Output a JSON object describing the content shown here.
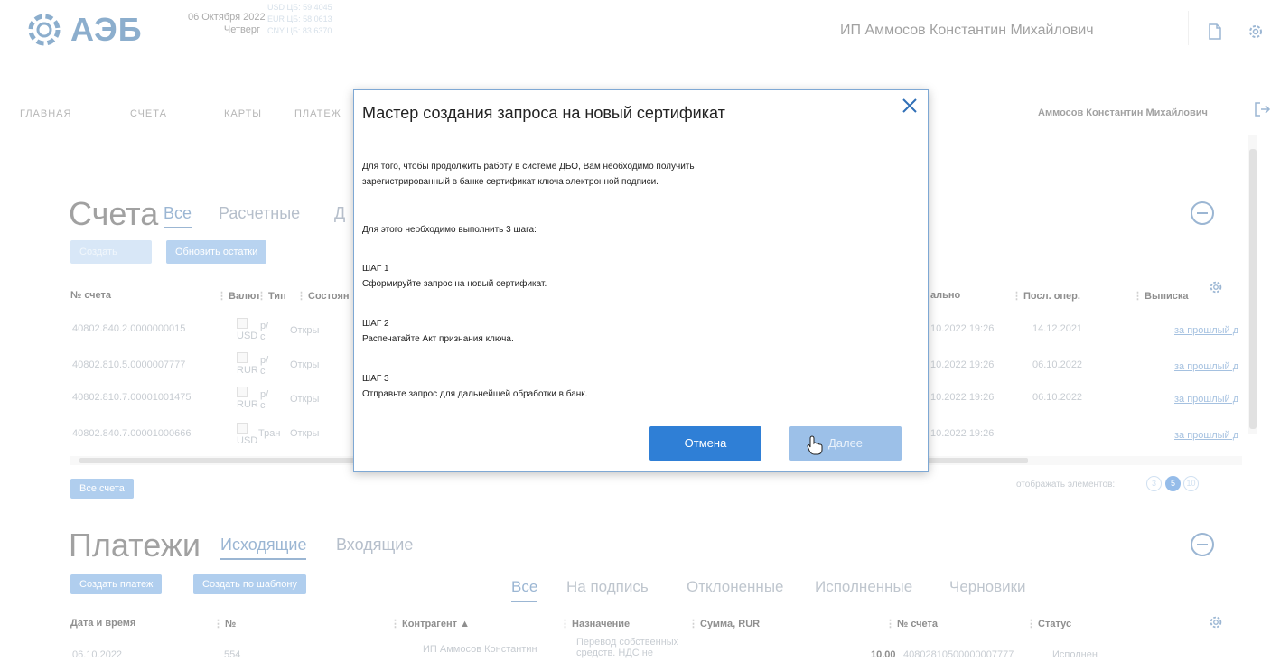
{
  "header": {
    "logo_text": "АЭБ",
    "date": "06 Октября 2022",
    "weekday": "Четверг",
    "rates": [
      "USD ЦБ: 59,4045",
      "EUR ЦБ: 58,0613",
      "CNY ЦБ: 83,6370"
    ],
    "company": "ИП Аммосов Константин Михайлович"
  },
  "nav": {
    "items": [
      "ГЛАВНАЯ",
      "СЧЕТА",
      "КАРТЫ",
      "ПЛАТЕЖ"
    ],
    "user": "Аммосов Константин Михайлович"
  },
  "accounts": {
    "title": "Счета",
    "tabs": [
      "Все",
      "Расчетные",
      "Д"
    ],
    "btn_hidden": "Создать",
    "btn_refresh": "Обновить остатки",
    "columns": [
      "№ счета",
      "Валют",
      "Тип",
      "Состоян",
      "ально",
      "Посл. опер.",
      "Выписка"
    ],
    "rows": [
      {
        "number": "40802.840.2.0000000015",
        "currency": "USD",
        "type": "р/с",
        "state": "Откры",
        "date1": "10.2022 19:26",
        "last_op": "14.12.2021",
        "statement": "за прошлый д"
      },
      {
        "number": "40802.810.5.0000007777",
        "currency": "RUR",
        "type": "р/с",
        "state": "Откры",
        "date1": "10.2022 19:26",
        "last_op": "06.10.2022",
        "statement": "за прошлый д"
      },
      {
        "number": "40802.810.7.00001001475",
        "currency": "RUR",
        "type": "р/с",
        "state": "Откры",
        "date1": "10.2022 19:26",
        "last_op": "06.10.2022",
        "statement": "за прошлый д"
      },
      {
        "number": "40802.840.7.00001000666",
        "currency": "USD",
        "type": "Тран",
        "state": "Откры",
        "date1": "10.2022 19:26",
        "last_op": "",
        "statement": "за прошлый д"
      }
    ],
    "all_accounts_btn": "Все счета",
    "page_count_label": "отображать элементов:",
    "page_sizes": [
      "3",
      "5",
      "10"
    ]
  },
  "payments": {
    "title": "Платежи",
    "tabs": [
      "Исходящие",
      "Входящие"
    ],
    "btn_create": "Создать платеж",
    "btn_template": "Создать по шаблону",
    "status_tabs": [
      "Все",
      "На подпись",
      "Отклоненные",
      "Исполненные",
      "Черновики"
    ],
    "columns": [
      "Дата и время",
      "№",
      "Контрагент ▲",
      "Назначение",
      "Сумма, RUR",
      "№ счета",
      "Статус"
    ],
    "row": {
      "date": "06.10.2022",
      "number": "554",
      "counterparty": "ИП Аммосов Константин",
      "purpose_1": "Перевод собственных",
      "purpose_2": "средств. НДС не",
      "amount": "10.00",
      "account": "40802810500000007777",
      "status": "Исполнен"
    }
  },
  "modal": {
    "title": "Мастер создания запроса на новый сертификат",
    "intro_1": "Для того, чтобы продолжить работу в системе ДБО, Вам необходимо получить",
    "intro_2": "зарегистрированный в банке сертификат ключа электронной подписи.",
    "steps_intro": "Для этого необходимо выполнить 3 шага:",
    "step1_label": "ШАГ 1",
    "step1_text": "Сформируйте запрос на новый сертификат.",
    "step2_label": "ШАГ 2",
    "step2_text": "Распечатайте Акт признания ключа.",
    "step3_label": "ШАГ 3",
    "step3_text": "Отправьте запрос для дальнейшей обработки в банк.",
    "cancel_label": "Отмена",
    "next_label": "Далее"
  },
  "colors": {
    "brand": "#2e6ca4",
    "accent": "#3f86d8",
    "modal_border": "#7ea8d4"
  },
  "icons": [
    "logo-icon",
    "document-icon",
    "gear-icon",
    "logout-icon",
    "close-icon",
    "collapse-icon",
    "image-placeholder-icon",
    "cursor-icon"
  ]
}
